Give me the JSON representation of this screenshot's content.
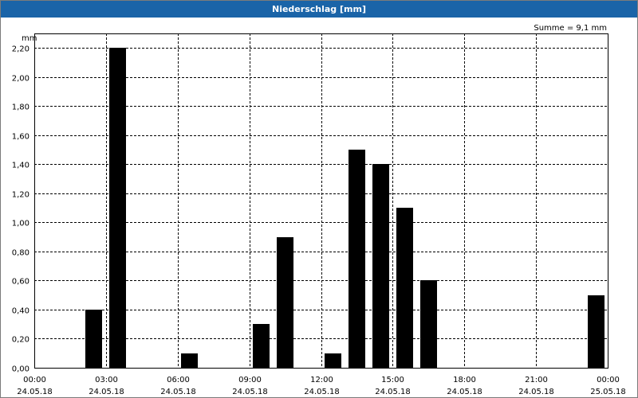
{
  "window": {
    "title": "Niederschlag [mm]"
  },
  "chart_data": {
    "type": "bar",
    "title": "Niederschlag [mm]",
    "ylabel": "mm",
    "annotation": "Summe = 9,1 mm",
    "ylim": [
      0,
      2.3
    ],
    "y_ticks": [
      "0,00",
      "0,20",
      "0,40",
      "0,60",
      "0,80",
      "1,00",
      "1,20",
      "1,40",
      "1,60",
      "1,80",
      "2,00",
      "2,20"
    ],
    "x_range_hours": [
      0,
      24
    ],
    "x_ticks": [
      {
        "time": "00:00",
        "date": "24.05.18"
      },
      {
        "time": "03:00",
        "date": "24.05.18"
      },
      {
        "time": "06:00",
        "date": "24.05.18"
      },
      {
        "time": "09:00",
        "date": "24.05.18"
      },
      {
        "time": "12:00",
        "date": "24.05.18"
      },
      {
        "time": "15:00",
        "date": "24.05.18"
      },
      {
        "time": "18:00",
        "date": "24.05.18"
      },
      {
        "time": "21:00",
        "date": "24.05.18"
      },
      {
        "time": "00:00",
        "date": "25.05.18"
      }
    ],
    "grid": true,
    "bar_color": "#000000",
    "points": [
      {
        "hour": 2.5,
        "value": 0.4
      },
      {
        "hour": 3.5,
        "value": 2.2
      },
      {
        "hour": 6.5,
        "value": 0.1
      },
      {
        "hour": 9.5,
        "value": 0.3
      },
      {
        "hour": 10.5,
        "value": 0.9
      },
      {
        "hour": 12.5,
        "value": 0.1
      },
      {
        "hour": 13.5,
        "value": 1.5
      },
      {
        "hour": 14.5,
        "value": 1.4
      },
      {
        "hour": 15.5,
        "value": 1.1
      },
      {
        "hour": 16.5,
        "value": 0.6
      },
      {
        "hour": 23.5,
        "value": 0.5
      }
    ]
  }
}
